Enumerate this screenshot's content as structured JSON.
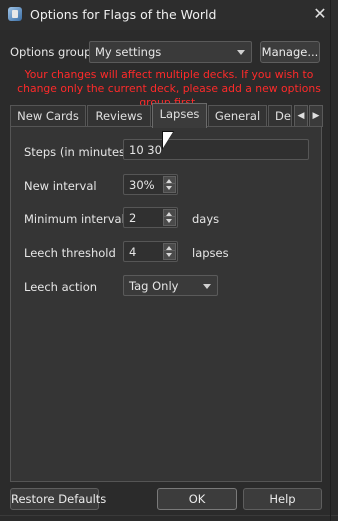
{
  "window": {
    "title": "Options for Flags of the World",
    "close_glyph": "✕"
  },
  "options_group": {
    "label": "Options group:",
    "selected": "My settings",
    "manage_label": "Manage..."
  },
  "warning": "Your changes will affect multiple decks. If you wish to change only the current deck, please add a new options group first.",
  "tabs": [
    {
      "label": "New Cards"
    },
    {
      "label": "Reviews"
    },
    {
      "label": "Lapses"
    },
    {
      "label": "General"
    },
    {
      "label": "De"
    }
  ],
  "tab_scroll": {
    "left": "◀",
    "right": "▶"
  },
  "lapses": {
    "steps_label": "Steps (in minutes)",
    "steps_value": "10 30",
    "new_interval_label": "New interval",
    "new_interval_value": "30%",
    "min_interval_label": "Minimum interval",
    "min_interval_value": "2",
    "min_interval_unit": "days",
    "leech_threshold_label": "Leech threshold",
    "leech_threshold_value": "4",
    "leech_threshold_unit": "lapses",
    "leech_action_label": "Leech action",
    "leech_action_value": "Tag Only"
  },
  "footer": {
    "restore_label": "Restore Defaults",
    "ok_label": "OK",
    "help_label": "Help"
  },
  "colors": {
    "warning": "#ff2a2a",
    "background": "#2b2b2b"
  }
}
